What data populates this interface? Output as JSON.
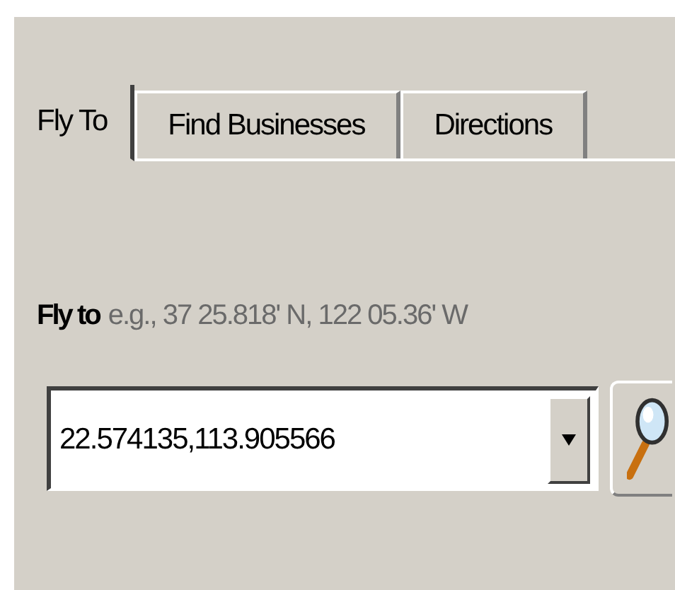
{
  "tabs": [
    {
      "label": "Fly To",
      "selected": true
    },
    {
      "label": "Find Businesses",
      "selected": false
    },
    {
      "label": "Directions",
      "selected": false
    }
  ],
  "fly_to": {
    "label": "Fly to",
    "hint": "e.g., 37 25.818' N, 122 05.36' W",
    "value": "22.574135,113.905566"
  }
}
